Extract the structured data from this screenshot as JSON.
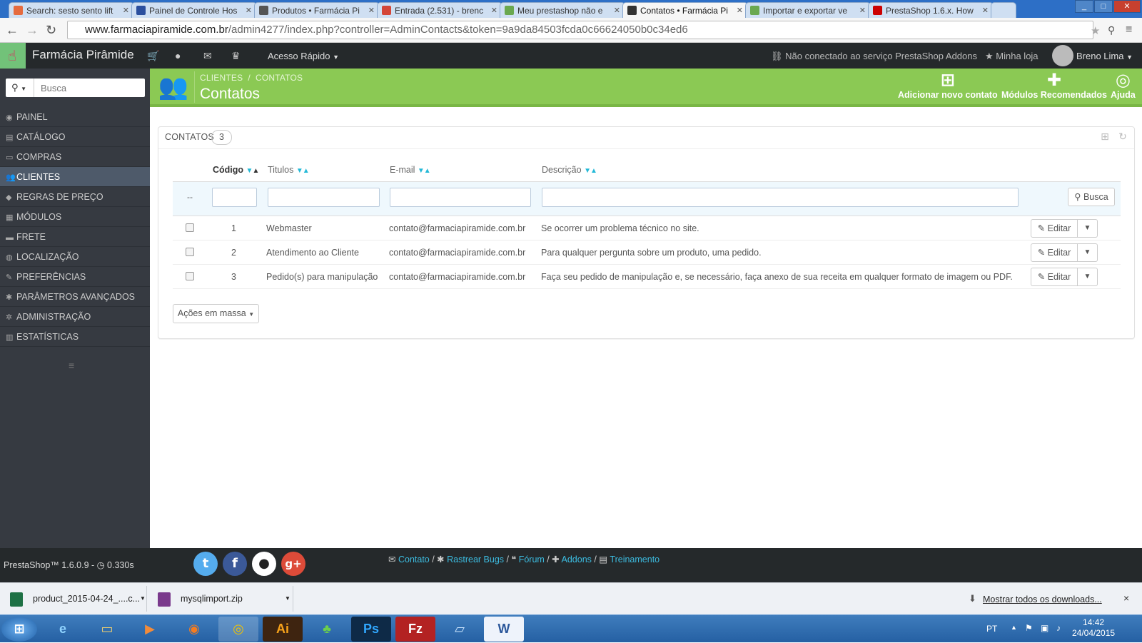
{
  "browser": {
    "tabs": [
      {
        "title": "Search: sesto sento lift",
        "favicon_color": "#e56b3f"
      },
      {
        "title": "Painel de Controle Hos",
        "favicon_color": "#2b4f9e"
      },
      {
        "title": "Produtos • Farmácia Pi",
        "favicon_color": "#555555"
      },
      {
        "title": "Entrada (2.531) - brenc",
        "favicon_color": "#d44638"
      },
      {
        "title": "Meu prestashop não e",
        "favicon_color": "#6aa84f"
      },
      {
        "title": "Contatos • Farmácia Pi",
        "favicon_color": "#333333",
        "active": true
      },
      {
        "title": "Importar e exportar ve",
        "favicon_color": "#6aa84f"
      },
      {
        "title": "PrestaShop 1.6.x. How",
        "favicon_color": "#cc0000"
      }
    ],
    "url_domain": "www.farmaciapiramide.com.br",
    "url_path": "/admin4277/index.php?controller=AdminContacts&token=9a9da84503fcda0c66624050b0c34ed6"
  },
  "header": {
    "shop_name": "Farmácia Pirâmide",
    "quick_access": "Acesso Rápido",
    "addons_status": "Não conectado ao serviço PrestaShop Addons",
    "my_shop": "Minha loja",
    "user_name": "Breno Lima"
  },
  "sidebar": {
    "search_placeholder": "Busca",
    "items": [
      {
        "label": "PAINEL",
        "icon": "dashboard-icon",
        "glyph": "◉"
      },
      {
        "label": "CATÁLOGO",
        "icon": "book-icon",
        "glyph": "▤"
      },
      {
        "label": "COMPRAS",
        "icon": "credit-card-icon",
        "glyph": "▭"
      },
      {
        "label": "CLIENTES",
        "icon": "users-icon",
        "glyph": "👥",
        "active": true
      },
      {
        "label": "REGRAS DE PREÇO",
        "icon": "tag-icon",
        "glyph": "◆"
      },
      {
        "label": "MÓDULOS",
        "icon": "puzzle-icon",
        "glyph": "▦"
      },
      {
        "label": "FRETE",
        "icon": "truck-icon",
        "glyph": "▬"
      },
      {
        "label": "LOCALIZAÇÃO",
        "icon": "globe-icon",
        "glyph": "◍"
      },
      {
        "label": "PREFERÊNCIAS",
        "icon": "wrench-icon",
        "glyph": "✎"
      },
      {
        "label": "PARÂMETROS AVANÇADOS",
        "icon": "cogs-icon",
        "glyph": "✱"
      },
      {
        "label": "ADMINISTRAÇÃO",
        "icon": "cog-icon",
        "glyph": "✲"
      },
      {
        "label": "ESTATÍSTICAS",
        "icon": "bar-chart-icon",
        "glyph": "▥"
      }
    ]
  },
  "toolbar": {
    "breadcrumb": [
      "CLIENTES",
      "CONTATOS"
    ],
    "title": "Contatos",
    "buttons": [
      {
        "label": "Adicionar novo contato",
        "icon": "add-icon"
      },
      {
        "label": "Módulos Recomendados",
        "icon": "puzzle-icon"
      },
      {
        "label": "Ajuda",
        "icon": "help-icon"
      }
    ]
  },
  "panel": {
    "title": "CONTATOS",
    "count": "3",
    "columns": [
      "Código",
      "Titulos",
      "E-mail",
      "Descrição"
    ],
    "filter_dash": "--",
    "search_button": "Busca",
    "rows": [
      {
        "id": "1",
        "title": "Webmaster",
        "email": "contato@farmaciapiramide.com.br",
        "description": "Se ocorrer um problema técnico no site."
      },
      {
        "id": "2",
        "title": "Atendimento ao Cliente",
        "email": "contato@farmaciapiramide.com.br",
        "description": "Para qualquer pergunta sobre um produto, uma pedido."
      },
      {
        "id": "3",
        "title": "Pedido(s) para manipulação",
        "email": "contato@farmaciapiramide.com.br",
        "description": "Faça seu pedido de manipulação e, se necessário, faça anexo de sua receita em qualquer formato de imagem ou PDF."
      }
    ],
    "edit_label": "Editar",
    "bulk_actions": "Ações em massa"
  },
  "footer": {
    "version": "PrestaShop™ 1.6.0.9 - ",
    "load_time": "0.330s",
    "links": [
      "Contato",
      "Rastrear Bugs",
      "Fórum",
      "Addons",
      "Treinamento"
    ]
  },
  "downloads": {
    "items": [
      "product_2015-04-24_....c...",
      "mysqlimport.zip"
    ],
    "show_all": "Mostrar todos os downloads...",
    "close": "×"
  },
  "taskbar": {
    "language": "PT",
    "time": "14:42",
    "date": "24/04/2015"
  }
}
